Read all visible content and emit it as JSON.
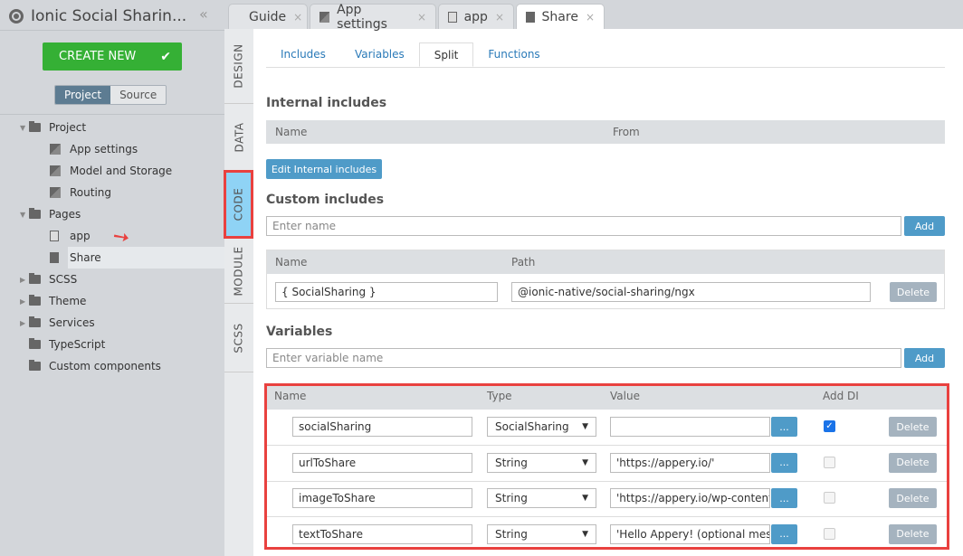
{
  "app": {
    "title": "Ionic Social Sharin...",
    "create_new": "CREATE NEW",
    "segments": [
      "Project",
      "Source"
    ]
  },
  "tree": [
    {
      "label": "Project",
      "type": "folder",
      "expanded": true,
      "level": 0
    },
    {
      "label": "App settings",
      "type": "settings",
      "level": 1
    },
    {
      "label": "Model and Storage",
      "type": "settings",
      "level": 1
    },
    {
      "label": "Routing",
      "type": "settings",
      "level": 1
    },
    {
      "label": "Pages",
      "type": "folder",
      "expanded": true,
      "level": 0
    },
    {
      "label": "app",
      "type": "page",
      "level": 1
    },
    {
      "label": "Share",
      "type": "page",
      "level": 1,
      "selected": true
    },
    {
      "label": "SCSS",
      "type": "folder",
      "expanded": false,
      "level": 0
    },
    {
      "label": "Theme",
      "type": "folder",
      "expanded": false,
      "level": 0
    },
    {
      "label": "Services",
      "type": "folder",
      "expanded": false,
      "level": 0
    },
    {
      "label": "TypeScript",
      "type": "folder",
      "level": 0
    },
    {
      "label": "Custom components",
      "type": "folder",
      "level": 0
    }
  ],
  "tabs": [
    "Guide",
    "App settings",
    "app",
    "Share"
  ],
  "vtabs": [
    "DESIGN",
    "DATA",
    "CODE",
    "MODULE",
    "SCSS"
  ],
  "subtabs": [
    "Includes",
    "Variables",
    "Split",
    "Functions"
  ],
  "internal": {
    "title": "Internal includes",
    "cols": [
      "Name",
      "From"
    ],
    "button": "Edit Internal includes"
  },
  "custom": {
    "title": "Custom includes",
    "placeholder": "Enter name",
    "add": "Add",
    "cols": [
      "Name",
      "Path"
    ],
    "row": {
      "name": "{ SocialSharing }",
      "path": "@ionic-native/social-sharing/ngx",
      "delete": "Delete"
    }
  },
  "variables": {
    "title": "Variables",
    "placeholder": "Enter variable name",
    "add": "Add",
    "cols": [
      "Name",
      "Type",
      "Value",
      "Add DI"
    ],
    "rows": [
      {
        "name": "socialSharing",
        "type": "SocialSharing",
        "value": "",
        "add_di": true
      },
      {
        "name": "urlToShare",
        "type": "String",
        "value": "'https://appery.io/'",
        "add_di": false
      },
      {
        "name": "imageToShare",
        "type": "String",
        "value": "'https://appery.io/wp-content/",
        "add_di": false
      },
      {
        "name": "textToShare",
        "type": "String",
        "value": "'Hello Appery! (optional message)'",
        "add_di": false
      }
    ],
    "more": "...",
    "delete": "Delete"
  },
  "colors": {
    "accent": "#4f9bc8",
    "create": "#35b035",
    "highlight": "#e9413f"
  }
}
